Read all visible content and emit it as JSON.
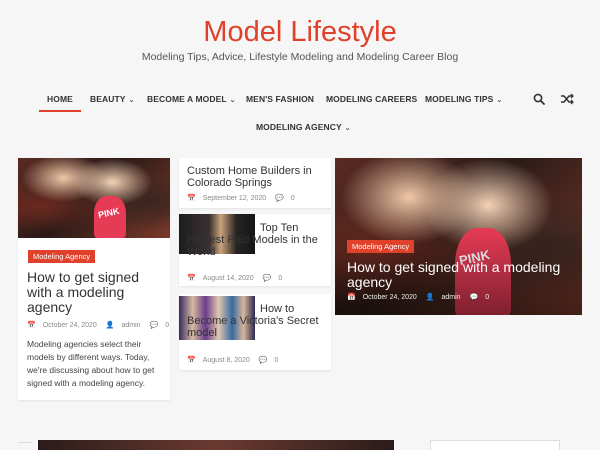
{
  "site": {
    "title": "Model Lifestyle",
    "description": "Modeling Tips, Advice, Lifestyle Modeling and Modeling Career Blog"
  },
  "nav": {
    "items": [
      {
        "label": "HOME",
        "has_dropdown": false,
        "active": true
      },
      {
        "label": "BEAUTY",
        "has_dropdown": true
      },
      {
        "label": "BECOME A MODEL",
        "has_dropdown": true
      },
      {
        "label": "MEN'S FASHION",
        "has_dropdown": false
      },
      {
        "label": "MODELING CAREERS",
        "has_dropdown": false
      },
      {
        "label": "MODELING TIPS",
        "has_dropdown": true
      },
      {
        "label": "MODELING AGENCY",
        "has_dropdown": true
      }
    ],
    "icons": [
      "search-icon",
      "random-icon"
    ]
  },
  "colors": {
    "accent": "#e0412a",
    "background": "#f6f6f6"
  },
  "featured_left": {
    "category": "Modeling Agency",
    "title": "How to get signed with a modeling agency",
    "date": "October 24, 2020",
    "author": "admin",
    "comments": "0",
    "excerpt": "Modeling agencies select their models by different ways. Today, we're discussing about how to get signed with a modeling agency."
  },
  "middle_posts": [
    {
      "title": "Custom Home Builders in Colorado Springs",
      "date": "September 12, 2020",
      "comments": "0"
    },
    {
      "title": "Top Ten Highest Paid Models in the World",
      "date": "August 14, 2020",
      "comments": "0"
    },
    {
      "title": "How to Become a Victoria's Secret model",
      "date": "August 8, 2020",
      "comments": "0"
    }
  ],
  "featured_right": {
    "category": "Modeling Agency",
    "title": "How to get signed with a modeling agency",
    "date": "October 24, 2020",
    "author": "admin",
    "comments": "0"
  }
}
